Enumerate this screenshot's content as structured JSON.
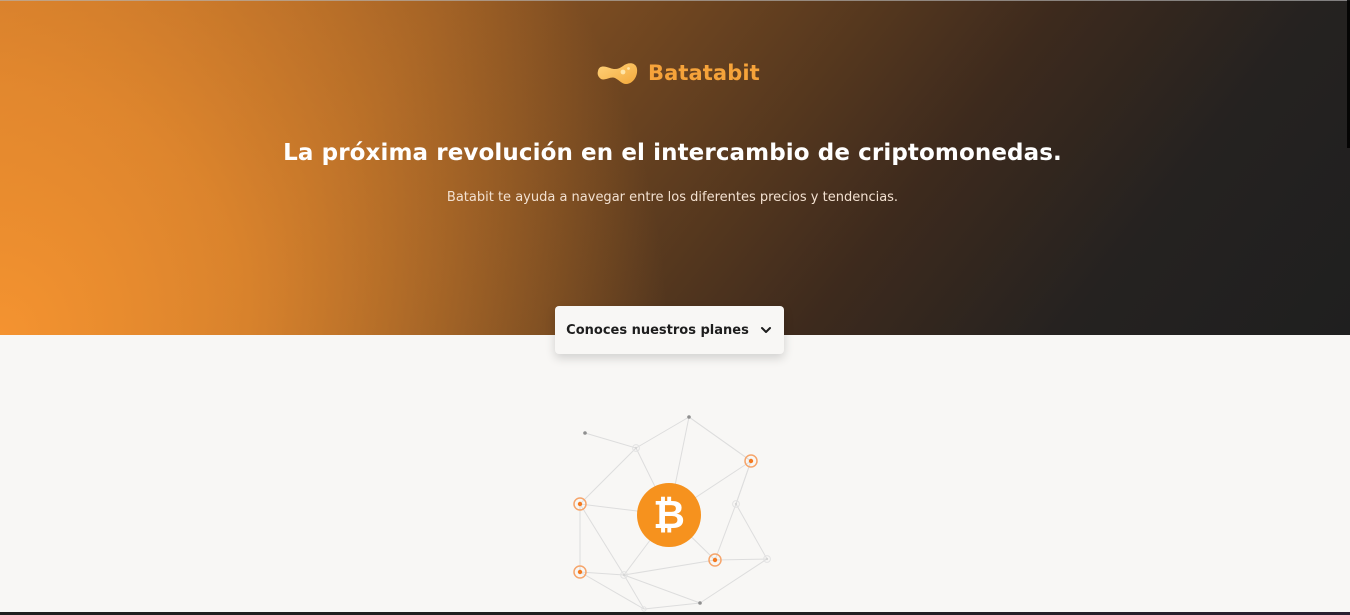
{
  "brand": {
    "name": "Batatabit",
    "logo_icon": "potato-logo-icon",
    "accent_color": "#f6a33a"
  },
  "hero": {
    "title": "La próxima revolución en el intercambio de criptomonedas.",
    "subtitle": "Batabit te ayuda a navegar entre los diferentes precios y tendencias.",
    "gradient_colors": [
      "#f69430",
      "#8e5623",
      "#1f1f1f"
    ]
  },
  "plans": {
    "label": "Conoces nuestros planes",
    "icon": "chevron-down-icon"
  },
  "illustration": {
    "center_icon": "bitcoin-icon",
    "network_icon": "network-nodes-icon",
    "bitcoin_color": "#f7931a"
  }
}
